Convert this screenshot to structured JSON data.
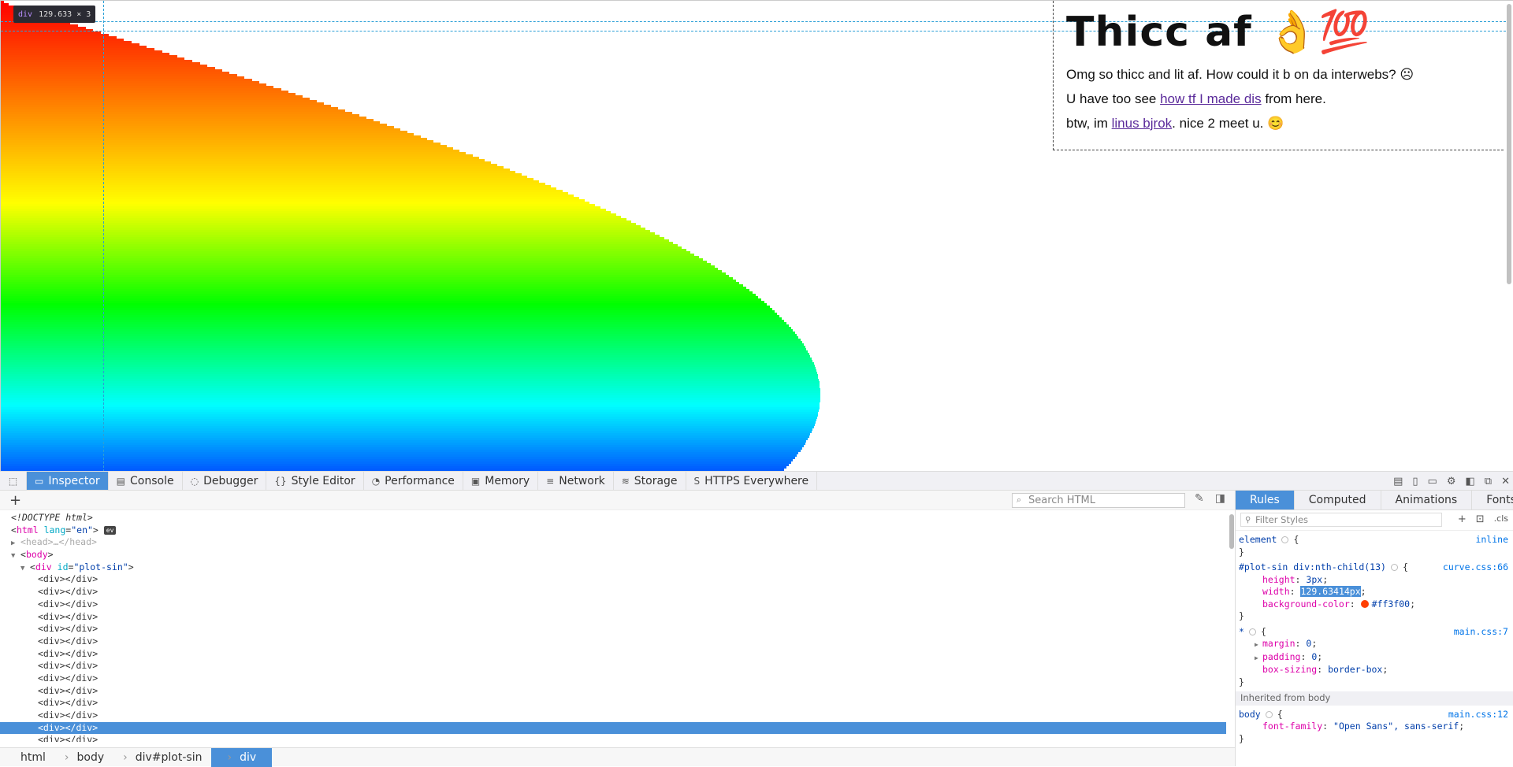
{
  "page": {
    "tooltip": {
      "tag": "div",
      "size": "129.633 × 3"
    },
    "plot_colors": [
      "#ff0000",
      "#ff7f00",
      "#ffff00",
      "#00ff00",
      "#00ffff",
      "#0000ff"
    ],
    "heading": "Thicc af 👌💯",
    "line1": "Omg so thicc and lit af. How could it b on da interwebs? ☹",
    "line2_pre": "U have too see ",
    "line2_link": "how tf I made dis",
    "line2_post": " from here.",
    "line3_pre": "btw, im ",
    "line3_link": "linus bjrok",
    "line3_post": ". nice 2 meet u. 😊"
  },
  "devtools": {
    "tabs": [
      {
        "label": "Inspector",
        "icon": "inspector-icon"
      },
      {
        "label": "Console",
        "icon": "console-icon"
      },
      {
        "label": "Debugger",
        "icon": "debugger-icon"
      },
      {
        "label": "Style Editor",
        "icon": "style-editor-icon"
      },
      {
        "label": "Performance",
        "icon": "performance-icon"
      },
      {
        "label": "Memory",
        "icon": "memory-icon"
      },
      {
        "label": "Network",
        "icon": "network-icon"
      },
      {
        "label": "Storage",
        "icon": "storage-icon"
      },
      {
        "label": "HTTPS Everywhere",
        "icon": "https-everywhere-icon"
      }
    ],
    "search_placeholder": "Search HTML",
    "tree": {
      "doctype": "<!DOCTYPE html>",
      "html_tag": "html",
      "html_attr": "lang",
      "html_val": "\"en\"",
      "ev_badge": "ev",
      "head": "<head>…</head>",
      "body": "body",
      "plot_div_attr": "id",
      "plot_div_val": "\"plot-sin\"",
      "child": "<div></div>"
    },
    "breadcrumbs": [
      "html",
      "body",
      "div#plot-sin",
      "div"
    ],
    "side_tabs": [
      "Rules",
      "Computed",
      "Animations",
      "Fonts"
    ],
    "filter_placeholder": "Filter Styles",
    "cls_label": ".cls",
    "rules": {
      "element_sel": "element",
      "element_src": "inline",
      "r1_sel": "#plot-sin div:nth-child(13)",
      "r1_src": "curve.css:66",
      "r1_height_n": "height",
      "r1_height_v": "3px",
      "r1_width_n": "width",
      "r1_width_v": "129.63414px",
      "r1_bg_n": "background-color",
      "r1_bg_v": "#ff3f00",
      "r2_sel": "*",
      "r2_src": "main.css:7",
      "r2_margin_n": "margin",
      "r2_margin_v": "0",
      "r2_padding_n": "padding",
      "r2_padding_v": "0",
      "r2_box_n": "box-sizing",
      "r2_box_v": "border-box",
      "inherited": "Inherited from body",
      "r3_sel": "body",
      "r3_src": "main.css:12",
      "r3_font_n": "font-family",
      "r3_font_v": "\"Open Sans\", sans-serif"
    }
  }
}
